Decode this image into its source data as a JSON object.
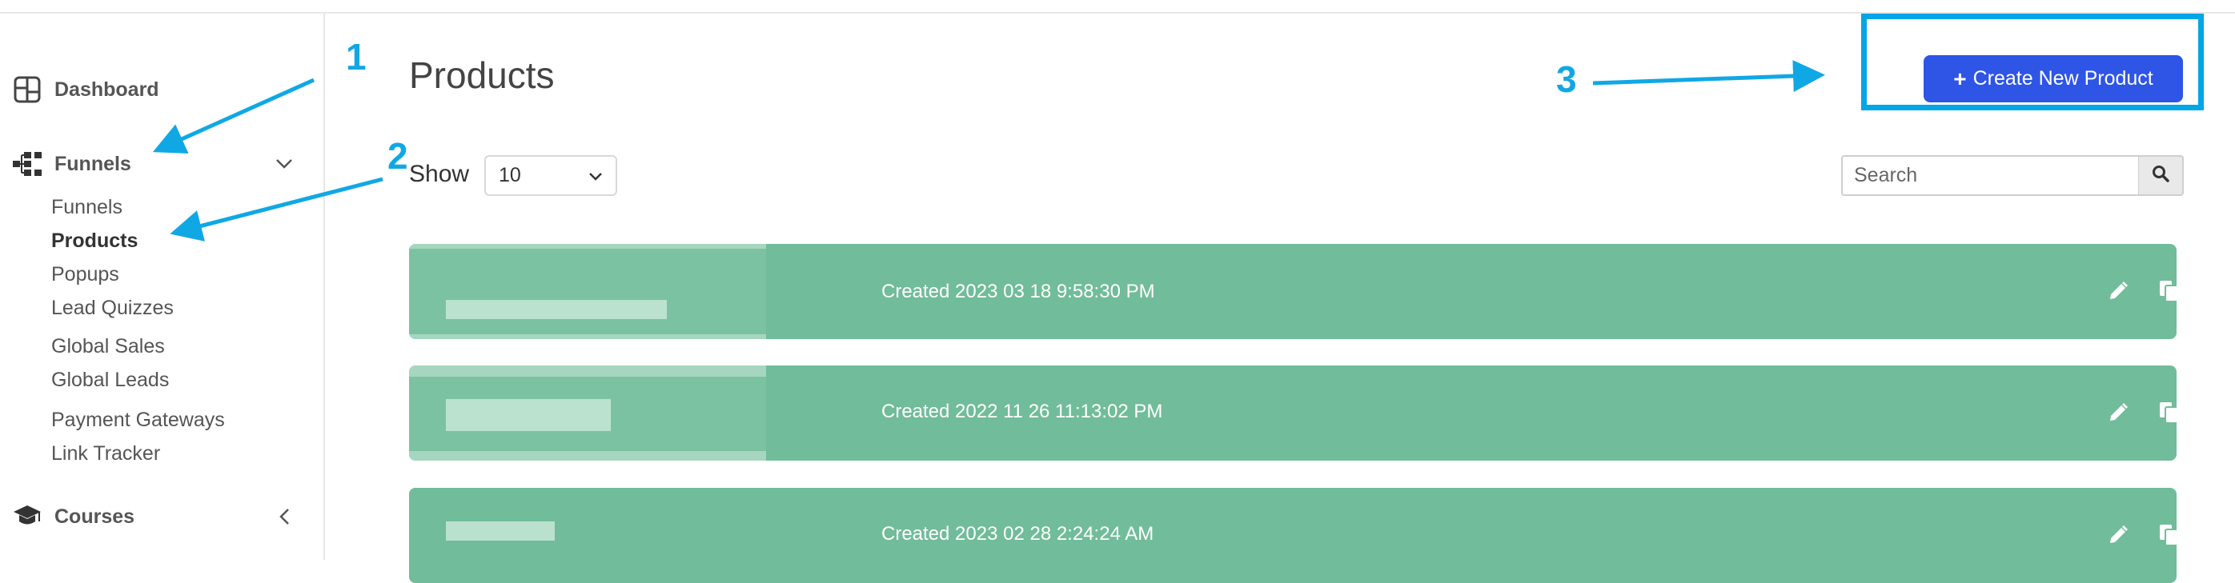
{
  "sidebar": {
    "dashboard": {
      "label": "Dashboard",
      "icon": "dashboard-grid-icon"
    },
    "funnels_section": {
      "label": "Funnels",
      "icon": "sitemap-icon",
      "expanded": true
    },
    "sub_items": [
      {
        "label": "Funnels",
        "active": false
      },
      {
        "label": "Products",
        "active": true
      },
      {
        "label": "Popups",
        "active": false
      },
      {
        "label": "Lead Quizzes",
        "active": false
      },
      {
        "label": "Global Sales",
        "active": false
      },
      {
        "label": "Global Leads",
        "active": false
      },
      {
        "label": "Payment Gateways",
        "active": false
      },
      {
        "label": "Link Tracker",
        "active": false
      }
    ],
    "courses_section": {
      "label": "Courses",
      "icon": "graduation-cap-icon",
      "expanded": false
    }
  },
  "main": {
    "title": "Products",
    "create_button": {
      "plus": "+",
      "label": "Create New Product"
    },
    "show_label": "Show",
    "show_select_value": "10",
    "search_placeholder": "Search",
    "rows": [
      {
        "created": "Created 2023 03 18 9:58:30 PM"
      },
      {
        "created": "Created 2022 11 26 11:13:02 PM"
      },
      {
        "created": "Created 2023 02 28 2:24:24 AM"
      }
    ]
  },
  "annotations": [
    "1",
    "2",
    "3"
  ],
  "colors": {
    "row_green": "#71bc9a",
    "primary_button": "#2e55e6",
    "annotation_blue": "#10a8e4"
  }
}
